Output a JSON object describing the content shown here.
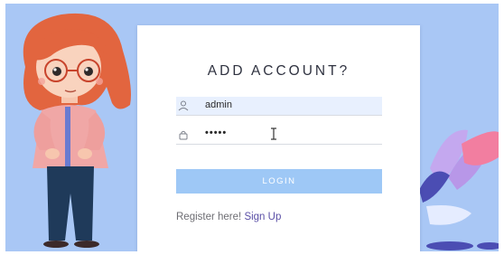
{
  "form": {
    "title": "ADD ACCOUNT?",
    "username": {
      "value": "admin",
      "icon": "user-icon"
    },
    "password": {
      "value": "•••••",
      "icon": "lock-icon"
    },
    "login_label": "LOGIN",
    "register_text": "Register here!",
    "signup_label": "Sign Up"
  },
  "colors": {
    "background": "#a9c7f5",
    "button": "#9ec8f6",
    "link": "#5a4fa6",
    "username_field_bg": "#e8f0fe"
  }
}
